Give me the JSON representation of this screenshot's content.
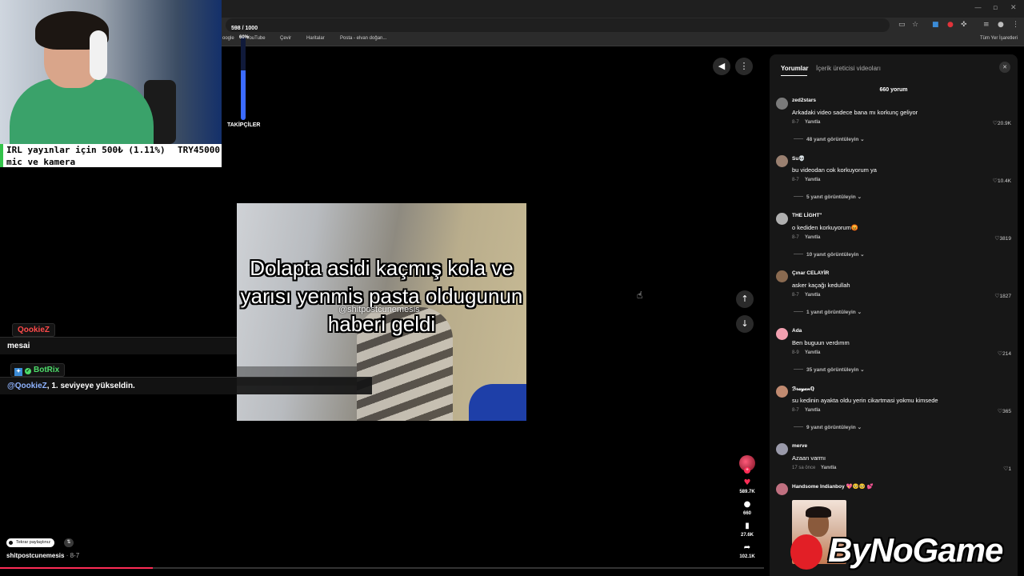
{
  "browser": {
    "bookmarks": [
      {
        "label": "oogle"
      },
      {
        "label": "YouTube"
      },
      {
        "label": "Çevir"
      },
      {
        "label": "Haritalar"
      },
      {
        "label": "Posta - elvan doğan..."
      }
    ],
    "all_bookmarks": "Tüm Yer İşaretleri"
  },
  "stream": {
    "donation": {
      "line1": "IRL yayınlar için  500₺ (1.11%)",
      "amount": "TRY45000",
      "line2": "mic ve kamera"
    },
    "follower_goal": {
      "count": "598 / 1000",
      "percent_label": "60%",
      "progress": 0.6,
      "label": "TAKİPÇİLER"
    }
  },
  "video": {
    "caption": "Dolapta asidi kaçmış kola ve yarısı yenmis pasta oldugunun haberi geldi",
    "watermark": "@shitpostcunemesis",
    "author": "shitpostcunemesis",
    "date": " · 8-7",
    "repost_label": "Tekrar paylaştınız",
    "progress": 0.2,
    "actions": {
      "likes": "589.7K",
      "comments": "660",
      "saves": "27.6K",
      "shares": "102.1K"
    }
  },
  "chat": [
    {
      "user": "QookieZ",
      "message": "mesai",
      "color": "#ff4a4a"
    },
    {
      "user": "BotRix",
      "mention": "@QookieZ",
      "message": ", 1. seviyeye yükseldin.",
      "color": "#4ddc6a"
    }
  ],
  "panel": {
    "tabs": [
      {
        "label": "Yorumlar",
        "active": true
      },
      {
        "label": "İçerik üreticisi videoları",
        "active": false
      }
    ],
    "comment_count": "660 yorum",
    "reply_label": "Yanıtla",
    "comments": [
      {
        "user": "zed2stars",
        "text": "Arkadaki video sadece bana mı korkunç geliyor",
        "date": "8-7",
        "likes": "20.9K",
        "view_replies": "48 yanıt görüntüleyin",
        "avatar_color": "#7a7a7a"
      },
      {
        "user": "Su💀",
        "text": "bu videodan cok korkuyorum ya",
        "date": "8-7",
        "likes": "10.4K",
        "view_replies": "5 yanıt görüntüleyin",
        "avatar_color": "#9a8070"
      },
      {
        "user": "THE LİGHT\"",
        "text": "o kediden korkuyorum😡",
        "date": "8-7",
        "likes": "3819",
        "view_replies": "10 yanıt görüntüleyin",
        "avatar_color": "#b0b0b0"
      },
      {
        "user": "Çınar CELAYİR",
        "text": "asker kaçağı kedullah",
        "date": "8-7",
        "likes": "1827",
        "view_replies": "1 yanıt görüntüleyin",
        "avatar_color": "#8a6a50"
      },
      {
        "user": "Ada",
        "text": "Ben buguun verdımm",
        "date": "8-9",
        "likes": "214",
        "view_replies": "35 yanıt görüntüleyin",
        "avatar_color": "#f2a0b0"
      },
      {
        "user": "ℬ𝓇𝒶𝓎𝒶𝓃ℚ",
        "text": "su kedinin ayakta oldu yerin cikartmasi yokmu kimsede",
        "date": "8-7",
        "likes": "365",
        "view_replies": "9 yanıt görüntüleyin",
        "avatar_color": "#c08a70"
      },
      {
        "user": "merve",
        "text": "Azaan varmı",
        "date": "17 sa önce",
        "likes": "1",
        "view_replies": "",
        "avatar_color": "#9a9aaa"
      },
      {
        "user": "Handsome Indianboy 💖🥺🥺 💕",
        "text": "",
        "date": "",
        "likes": "",
        "view_replies": "",
        "avatar_color": "#c07080"
      }
    ]
  },
  "overlay": {
    "logo_text": "ByNoGame"
  },
  "colors": {
    "accent": "#fe2c55",
    "panel_bg": "#171717",
    "goal_fill": "#3b6bff"
  }
}
